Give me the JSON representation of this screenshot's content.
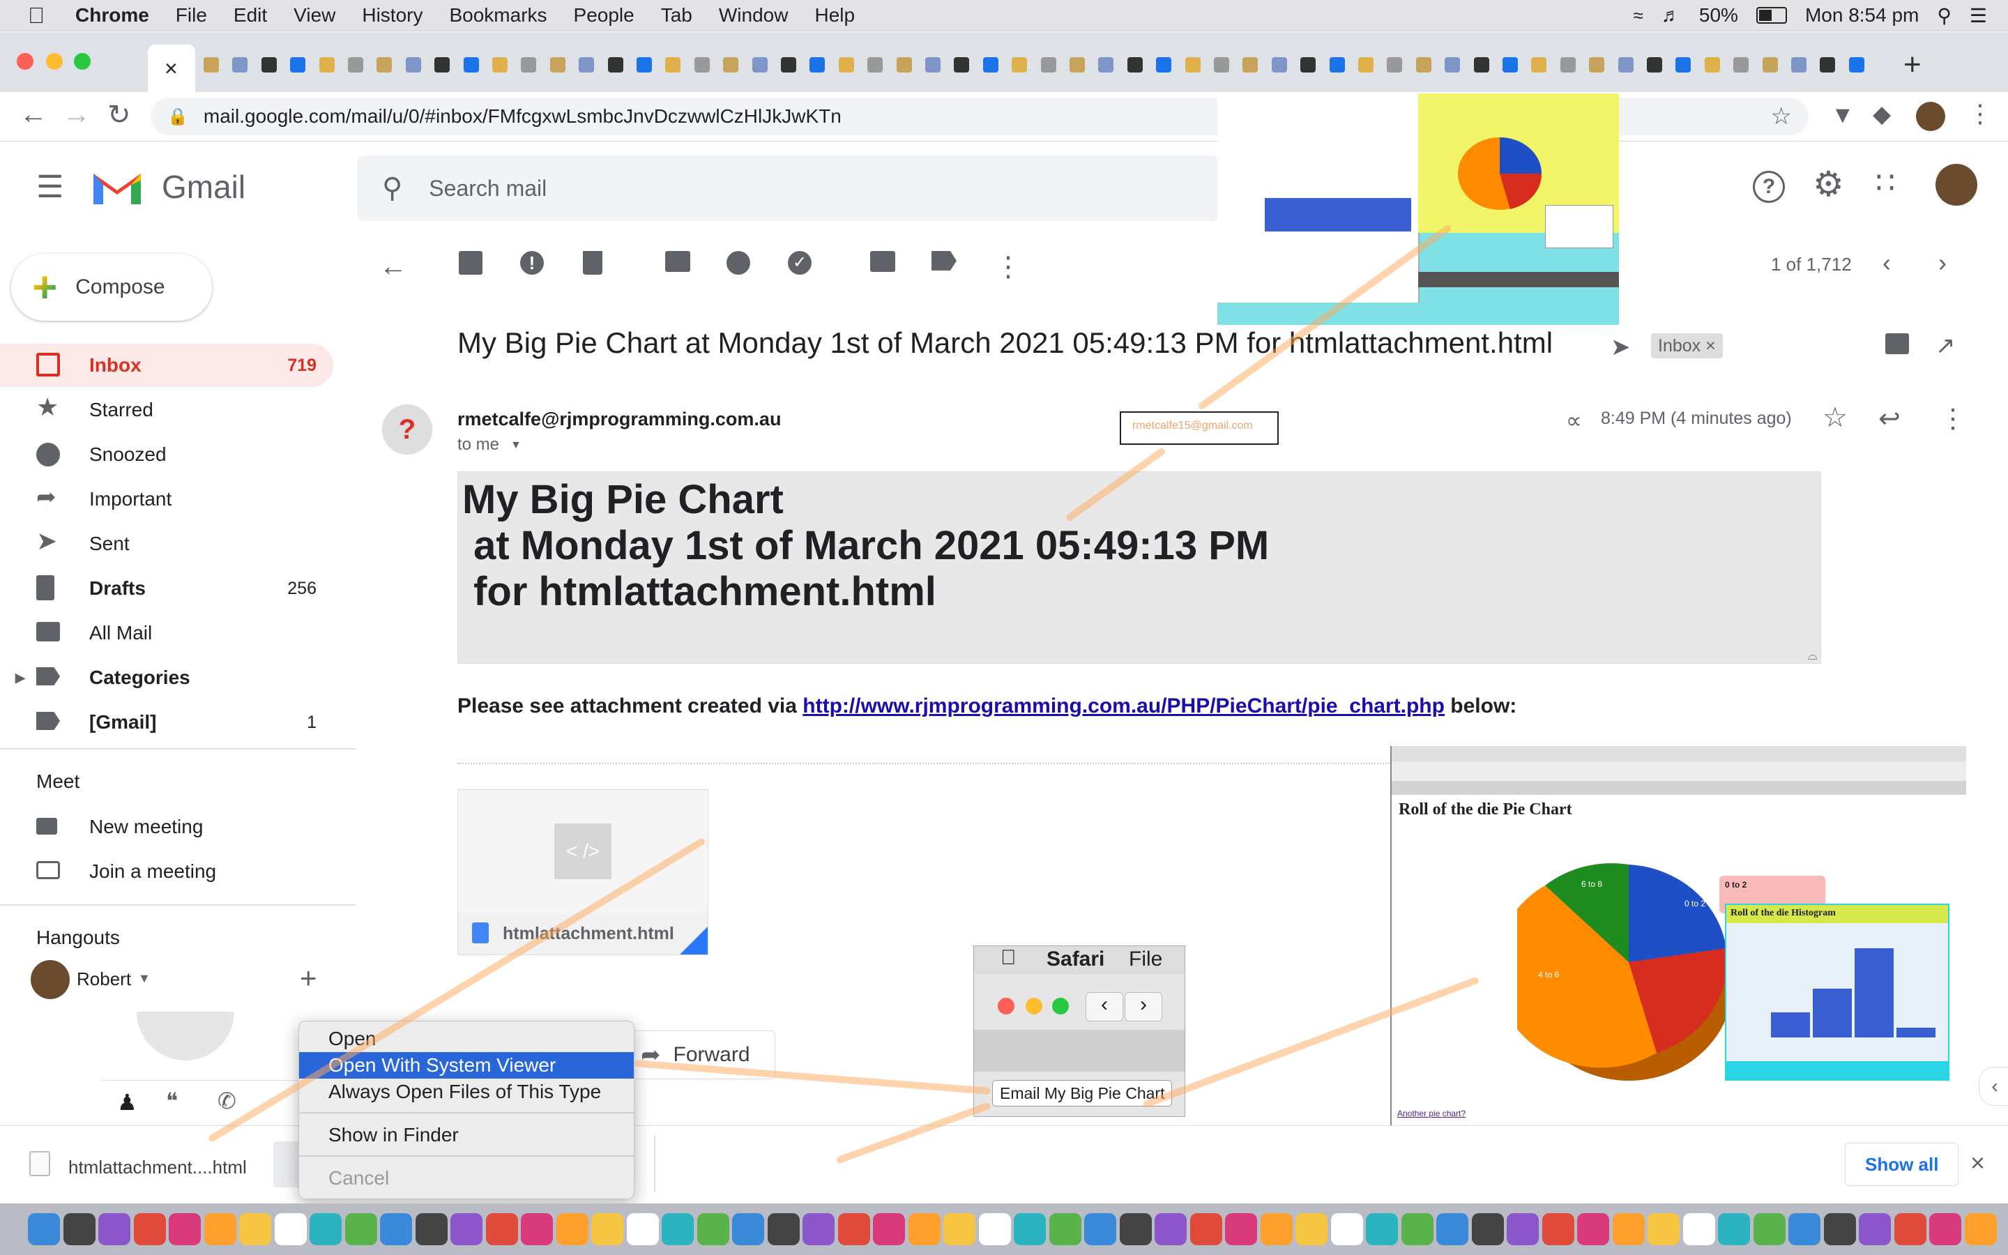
{
  "menubar": {
    "apple": "",
    "app_name": "Chrome",
    "items": [
      "File",
      "Edit",
      "View",
      "History",
      "Bookmarks",
      "People",
      "Tab",
      "Window",
      "Help"
    ],
    "battery": "50%",
    "clock": "Mon 8:54 pm"
  },
  "browser": {
    "url": "mail.google.com/mail/u/0/#inbox/FMfcgxwLsmbcJnvDczwwlCzHlJkJwKTn"
  },
  "gmail": {
    "product": "Gmail",
    "search_placeholder": "Search mail",
    "compose_label": "Compose",
    "nav": [
      {
        "label": "Inbox",
        "count": "719",
        "icon": "inbox-icon"
      },
      {
        "label": "Starred",
        "count": "",
        "icon": "star-icon"
      },
      {
        "label": "Snoozed",
        "count": "",
        "icon": "clock-icon"
      },
      {
        "label": "Important",
        "count": "",
        "icon": "important-icon"
      },
      {
        "label": "Sent",
        "count": "",
        "icon": "send-icon"
      },
      {
        "label": "Drafts",
        "count": "256",
        "icon": "draft-icon"
      },
      {
        "label": "All Mail",
        "count": "",
        "icon": "mail-icon"
      },
      {
        "label": "Categories",
        "count": "",
        "icon": "label-icon"
      },
      {
        "label": "[Gmail]",
        "count": "1",
        "icon": "label-icon"
      }
    ],
    "meet_header": "Meet",
    "meet_items": [
      "New meeting",
      "Join a meeting"
    ],
    "hangouts_header": "Hangouts",
    "hangouts_user": "Robert",
    "pagination": "1 of 1,712"
  },
  "message": {
    "subject": "My Big Pie Chart at Monday 1st of March 2021 05:49:13 PM for htmlattachment.html",
    "label_chip": "Inbox",
    "sender": "rmetcalfe@rjmprogramming.com.au",
    "to": "to me",
    "time": "8:49 PM (4 minutes ago)",
    "overlay_email": "rmetcalfe15@gmail.com",
    "body_lines": [
      "My Big Pie Chart",
      " at Monday 1st of March 2021 05:49:13 PM",
      " for htmlattachment.html"
    ],
    "note_prefix": "Please see attachment created via ",
    "note_link": "http://www.rjmprogramming.com.au/PHP/PieChart/pie_chart.php",
    "note_suffix": " below:",
    "attachment_name": "htmlattachment.html",
    "attachment_glyph": "< />",
    "forward_label": "Forward"
  },
  "context_menu": {
    "items": [
      "Open",
      "Open With System Viewer",
      "Always Open Files of This Type",
      "Show in Finder",
      "Cancel"
    ]
  },
  "shelf": {
    "file": "htmlattachment....html",
    "show_all": "Show all"
  },
  "safari_inset": {
    "app": "Safari",
    "menu": "File",
    "button": "Email My Big Pie Chart"
  },
  "pie_inset": {
    "title": "Roll of the die Pie Chart",
    "hist_title": "Roll of the die Histogram",
    "slice_labels": [
      "6 to 8",
      "0 to 2",
      "4 to 6"
    ],
    "tooltip": "0 to 2",
    "footer_link": "Another pie chart?"
  },
  "colors": {
    "gmail_red": "#d93025",
    "inbox_bg": "#fce8e6",
    "link": "#1a0dab",
    "orange": "#ff8c00",
    "pie_blue": "#1f4fc4",
    "pie_red": "#d62d1e",
    "pie_green": "#1e8c1e",
    "selection": "#2866d9"
  }
}
